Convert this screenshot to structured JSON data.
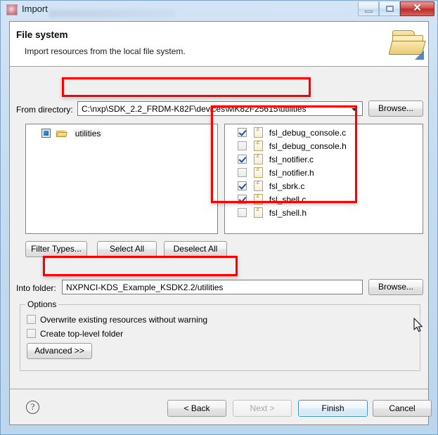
{
  "window": {
    "title": "Import",
    "icon": "import-wizard-icon",
    "caption_buttons": {
      "minimize": "minimize-icon",
      "maximize": "maximize-icon",
      "close": "✕"
    }
  },
  "wizard": {
    "title": "File system",
    "description": "Import resources from the local file system.",
    "banner_icon": "open-folder-icon"
  },
  "from_directory": {
    "label": "From directory:",
    "value": "C:\\nxp\\SDK_2.2_FRDM-K82F\\devices\\MK82F25615\\utilities",
    "browse_label": "Browse..."
  },
  "tree": {
    "items": [
      {
        "label": "utilities",
        "state": "partial",
        "icon": "folder-icon"
      }
    ]
  },
  "files": {
    "items": [
      {
        "name": "fsl_debug_console.c",
        "checked": true,
        "icon": "c-file-icon"
      },
      {
        "name": "fsl_debug_console.h",
        "checked": false,
        "icon": "c-file-icon"
      },
      {
        "name": "fsl_notifier.c",
        "checked": true,
        "icon": "c-file-icon"
      },
      {
        "name": "fsl_notifier.h",
        "checked": false,
        "icon": "c-file-icon"
      },
      {
        "name": "fsl_sbrk.c",
        "checked": true,
        "icon": "c-file-icon"
      },
      {
        "name": "fsl_shell.c",
        "checked": true,
        "icon": "c-file-icon"
      },
      {
        "name": "fsl_shell.h",
        "checked": false,
        "icon": "c-file-icon"
      }
    ]
  },
  "actions": {
    "filter_types": "Filter Types...",
    "select_all": "Select All",
    "deselect_all": "Deselect All"
  },
  "into_folder": {
    "label": "Into folder:",
    "value": "NXPNCI-KDS_Example_KSDK2.2/utilities",
    "browse_label": "Browse..."
  },
  "options": {
    "legend": "Options",
    "items": [
      {
        "label": "Overwrite existing resources without warning",
        "checked": false
      },
      {
        "label": "Create top-level folder",
        "checked": false
      }
    ],
    "advanced_label": "Advanced >>"
  },
  "footer": {
    "help_icon": "?",
    "back": "< Back",
    "next": "Next >",
    "finish": "Finish",
    "cancel": "Cancel"
  },
  "annotations": {
    "color": "#fc0000",
    "boxes": [
      "from-directory-field",
      "file-list",
      "into-folder-field"
    ]
  }
}
